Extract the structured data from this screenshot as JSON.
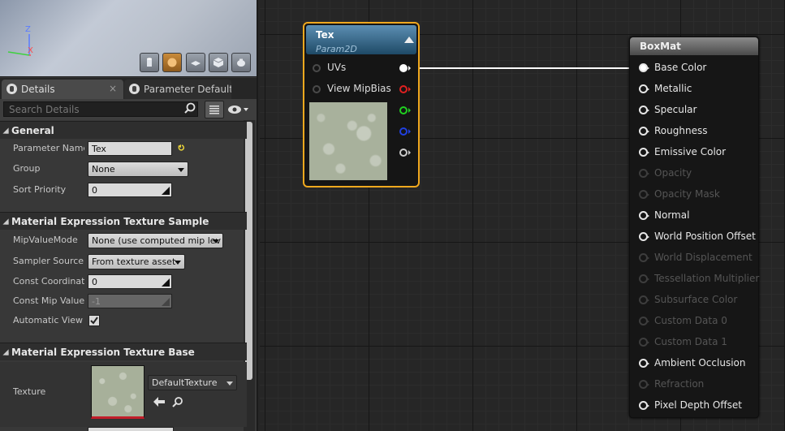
{
  "viewport": {
    "axis_z": "Z",
    "axis_x": "X",
    "preview_buttons": [
      {
        "name": "cylinder-icon"
      },
      {
        "name": "sphere-icon"
      },
      {
        "name": "plane-icon"
      },
      {
        "name": "cube-icon"
      },
      {
        "name": "teapot-icon"
      }
    ]
  },
  "tabs": {
    "details": "Details",
    "details_close": "×",
    "parameter_defaults": "Parameter Defaults"
  },
  "search": {
    "placeholder": "Search Details"
  },
  "sections": {
    "general": "General",
    "texture_sample": "Material Expression Texture Sample",
    "texture_base": "Material Expression Texture Base"
  },
  "general": {
    "parameter_name_label": "Parameter Name",
    "parameter_name_value": "Tex",
    "group_label": "Group",
    "group_value": "None",
    "sort_priority_label": "Sort Priority",
    "sort_priority_value": "0"
  },
  "texture_sample": {
    "mip_value_mode_label": "MipValueMode",
    "mip_value_mode_value": "None (use computed mip lev",
    "sampler_source_label": "Sampler Source",
    "sampler_source_value": "From texture asset",
    "const_coordinate_label": "Const Coordinate",
    "const_coordinate_value": "0",
    "const_mip_value_label": "Const Mip Value",
    "const_mip_value_value": "-1",
    "automatic_view_label": "Automatic View M",
    "automatic_view_checked": true
  },
  "texture_base": {
    "texture_label": "Texture",
    "texture_value": "DefaultTexture"
  },
  "tex_node": {
    "title": "Tex",
    "subtitle": "Param2D",
    "inputs": [
      "UVs",
      "View MipBias"
    ],
    "outputs": [
      {
        "color": "#ffffff"
      },
      {
        "color": "#e02020"
      },
      {
        "color": "#20d020"
      },
      {
        "color": "#2040e0"
      },
      {
        "color": "#cccccc"
      }
    ]
  },
  "box_node": {
    "title": "BoxMat",
    "inputs": [
      {
        "label": "Base Color",
        "enabled": true,
        "connected": true
      },
      {
        "label": "Metallic",
        "enabled": true,
        "connected": false
      },
      {
        "label": "Specular",
        "enabled": true,
        "connected": false
      },
      {
        "label": "Roughness",
        "enabled": true,
        "connected": false
      },
      {
        "label": "Emissive Color",
        "enabled": true,
        "connected": false
      },
      {
        "label": "Opacity",
        "enabled": false,
        "connected": false
      },
      {
        "label": "Opacity Mask",
        "enabled": false,
        "connected": false
      },
      {
        "label": "Normal",
        "enabled": true,
        "connected": false
      },
      {
        "label": "World Position Offset",
        "enabled": true,
        "connected": false
      },
      {
        "label": "World Displacement",
        "enabled": false,
        "connected": false
      },
      {
        "label": "Tessellation Multiplier",
        "enabled": false,
        "connected": false
      },
      {
        "label": "Subsurface Color",
        "enabled": false,
        "connected": false
      },
      {
        "label": "Custom Data 0",
        "enabled": false,
        "connected": false
      },
      {
        "label": "Custom Data 1",
        "enabled": false,
        "connected": false
      },
      {
        "label": "Ambient Occlusion",
        "enabled": true,
        "connected": false
      },
      {
        "label": "Refraction",
        "enabled": false,
        "connected": false
      },
      {
        "label": "Pixel Depth Offset",
        "enabled": true,
        "connected": false
      }
    ]
  },
  "colors": {
    "selection_outline": "#f0a81e",
    "tex_header": "#2e6a94",
    "boxmat_header": "#6a6a6a"
  }
}
